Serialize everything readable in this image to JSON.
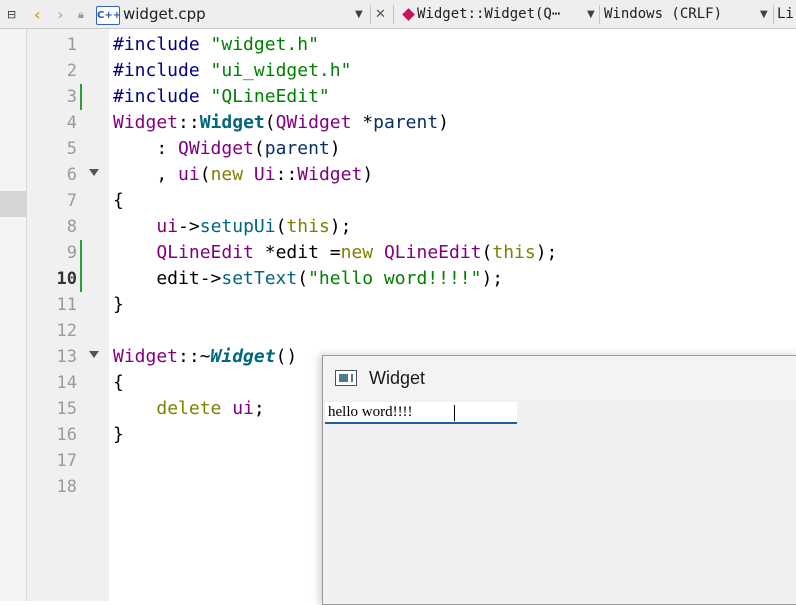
{
  "toolbar": {
    "file_icon_label": "C++",
    "filename": "widget.cpp",
    "symbol": "Widget::Widget(Q⋯",
    "line_ending": "Windows (CRLF)",
    "extra": "Li"
  },
  "gutter": {
    "numbers": [
      "1",
      "2",
      "3",
      "4",
      "5",
      "6",
      "7",
      "8",
      "9",
      "10",
      "11",
      "12",
      "13",
      "14",
      "15",
      "16",
      "17",
      "18"
    ]
  },
  "code": {
    "l1_pp": "#include",
    "l1_str": "\"widget.h\"",
    "l2_pp": "#include",
    "l2_str": "\"ui_widget.h\"",
    "l3_pp": "#include",
    "l3_str": "\"QLineEdit\"",
    "l4_cls": "Widget",
    "l4_sep": "::",
    "l4_fn": "Widget",
    "l4_open": "(",
    "l4_ty": "QWidget",
    "l4_rest": " *",
    "l4_par": "parent",
    "l4_close": ")",
    "l5_colon": "    : ",
    "l5_ty": "QWidget",
    "l5_open": "(",
    "l5_par": "parent",
    "l5_close": ")",
    "l6_comma": "    , ",
    "l6_ui": "ui",
    "l6_open": "(",
    "l6_kw": "new",
    "l6_sp": " ",
    "l6_ty": "Ui",
    "l6_sep": "::",
    "l6_ty2": "Widget",
    "l6_close": ")",
    "l7": "{",
    "l8_ind": "    ",
    "l8_ui": "ui",
    "l8_arrow": "->",
    "l8_fn": "setupUi",
    "l8_open": "(",
    "l8_kw": "this",
    "l8_close": ");",
    "l9_ind": "    ",
    "l9_ty": "QLineEdit",
    "l9_mid": " *edit =",
    "l9_kw": "new",
    "l9_sp": " ",
    "l9_ty2": "QLineEdit",
    "l9_open": "(",
    "l9_kw2": "this",
    "l9_close": ");",
    "l10_ind": "    edit->",
    "l10_fn": "setText",
    "l10_open": "(",
    "l10_str": "\"hello word!!!!\"",
    "l10_close": ");",
    "l11": "}",
    "l13_cls": "Widget",
    "l13_sep": "::~",
    "l13_fn": "Widget",
    "l13_paren": "()",
    "l14": "{",
    "l15_ind": "    ",
    "l15_kw": "delete",
    "l15_sp": " ",
    "l15_ui": "ui",
    "l15_semi": ";",
    "l16": "}"
  },
  "widget_window": {
    "title": "Widget",
    "line_edit_value": "hello word!!!!"
  }
}
